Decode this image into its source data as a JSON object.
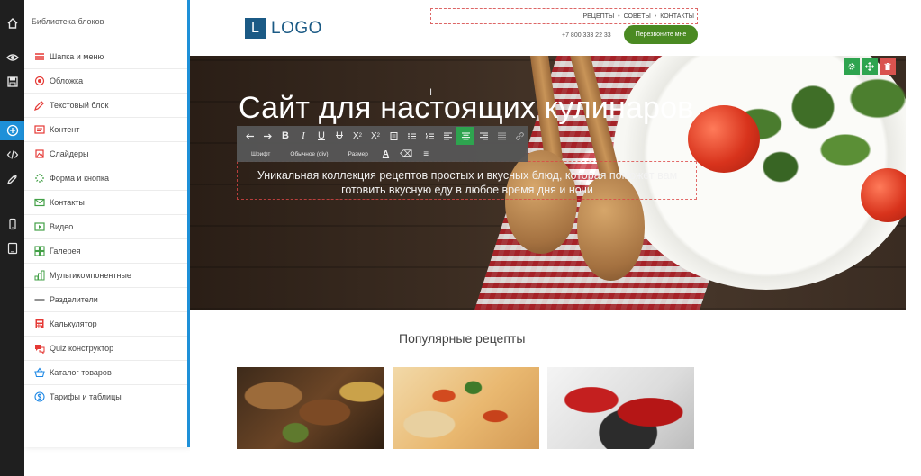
{
  "panel": {
    "title": "Библиотека блоков",
    "items": [
      {
        "label": "Шапка и меню",
        "icon": "menu-icon",
        "color": "#e53935"
      },
      {
        "label": "Обложка",
        "icon": "target-icon",
        "color": "#e53935"
      },
      {
        "label": "Текстовый блок",
        "icon": "pencil-icon",
        "color": "#e53935"
      },
      {
        "label": "Контент",
        "icon": "content-icon",
        "color": "#e53935"
      },
      {
        "label": "Слайдеры",
        "icon": "slider-icon",
        "color": "#e53935"
      },
      {
        "label": "Форма и кнопка",
        "icon": "cursor-click-icon",
        "color": "#43a047"
      },
      {
        "label": "Контакты",
        "icon": "envelope-icon",
        "color": "#43a047"
      },
      {
        "label": "Видео",
        "icon": "video-icon",
        "color": "#43a047"
      },
      {
        "label": "Галерея",
        "icon": "gallery-icon",
        "color": "#43a047"
      },
      {
        "label": "Мультикомпонентные",
        "icon": "multi-icon",
        "color": "#43a047"
      },
      {
        "label": "Разделители",
        "icon": "divider-icon",
        "color": "#777777"
      },
      {
        "label": "Калькулятор",
        "icon": "calculator-icon",
        "color": "#e53935"
      },
      {
        "label": "Quiz конструктор",
        "icon": "quiz-icon",
        "color": "#e53935"
      },
      {
        "label": "Каталог товаров",
        "icon": "basket-icon",
        "color": "#1e88e5"
      },
      {
        "label": "Тарифы и таблицы",
        "icon": "dollar-icon",
        "color": "#1e88e5"
      }
    ]
  },
  "site": {
    "logo": {
      "letter": "L",
      "text": "LOGO"
    },
    "nav": [
      "РЕЦЕПТЫ",
      "СОВЕТЫ",
      "КОНТАКТЫ"
    ],
    "nav_separator": "•",
    "phone": "+7 800 333 22 33",
    "call_button": "Перезвоните мне",
    "hero": {
      "title": "Сайт для настоящих кулинаров",
      "subtitle": "Уникальная коллекция рецептов простых и вкусных блюд, которая поможет вам готовить вкусную еду в любое время дня и ночи"
    },
    "popular_title": "Популярные рецепты"
  },
  "editor": {
    "font_label": "Шрифт",
    "format_label": "Обычное (div)",
    "size_label": "Размер"
  },
  "colors": {
    "accent": "#1e90d8",
    "toolbar_active": "#2ea44f",
    "delete": "#d9534f",
    "logo": "#1b5a85",
    "call_button": "#4a8a22"
  }
}
